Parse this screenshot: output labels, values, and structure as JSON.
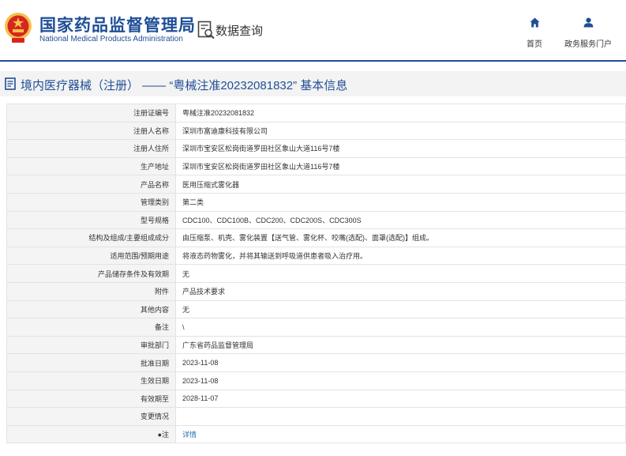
{
  "header": {
    "org_name_cn": "国家药品监督管理局",
    "org_name_en": "National Medical Products Administration",
    "query_label": "数据查询",
    "nav": {
      "home_label": "首页",
      "service_label": "政务服务门户"
    }
  },
  "page": {
    "title": "境内医疗器械（注册） —— “粤械注准20232081832” 基本信息"
  },
  "colors": {
    "brand_blue": "#1f4e96",
    "link_blue": "#2a6ebb",
    "emblem_red": "#d7261e",
    "emblem_gold": "#f2c14e"
  },
  "icons": {
    "emblem": "national-emblem-icon",
    "query": "data-query-icon",
    "home": "home-icon",
    "user": "user-icon",
    "title": "document-icon"
  },
  "fields": [
    {
      "label": "注册证编号",
      "value": "粤械注准20232081832"
    },
    {
      "label": "注册人名称",
      "value": "深圳市富迪康科技有限公司"
    },
    {
      "label": "注册人住所",
      "value": "深圳市宝安区松岗街道罗田社区象山大道116号7楼"
    },
    {
      "label": "生产地址",
      "value": "深圳市宝安区松岗街道罗田社区象山大道116号7楼"
    },
    {
      "label": "产品名称",
      "value": "医用压缩式雾化器"
    },
    {
      "label": "管理类别",
      "value": "第二类"
    },
    {
      "label": "型号规格",
      "value": "CDC100、CDC100B、CDC200、CDC200S、CDC300S"
    },
    {
      "label": "结构及组成/主要组成成分",
      "value": "由压缩泵、机壳、雾化装置【送气管、雾化杯、咬嘴(选配)、面罩(选配)】组成。"
    },
    {
      "label": "适用范围/预期用途",
      "value": "将液态药物雾化，并将其输送到呼吸道供患者吸入治疗用。"
    },
    {
      "label": "产品储存条件及有效期",
      "value": "无"
    },
    {
      "label": "附件",
      "value": "产品技术要求"
    },
    {
      "label": "其他内容",
      "value": "无"
    },
    {
      "label": "备注",
      "value": "\\"
    },
    {
      "label": "审批部门",
      "value": "广东省药品监督管理局"
    },
    {
      "label": "批准日期",
      "value": "2023-11-08"
    },
    {
      "label": "生效日期",
      "value": "2023-11-08"
    },
    {
      "label": "有效期至",
      "value": "2028-11-07"
    },
    {
      "label": "变更情况",
      "value": ""
    },
    {
      "label": "●注",
      "value": "详情"
    }
  ]
}
